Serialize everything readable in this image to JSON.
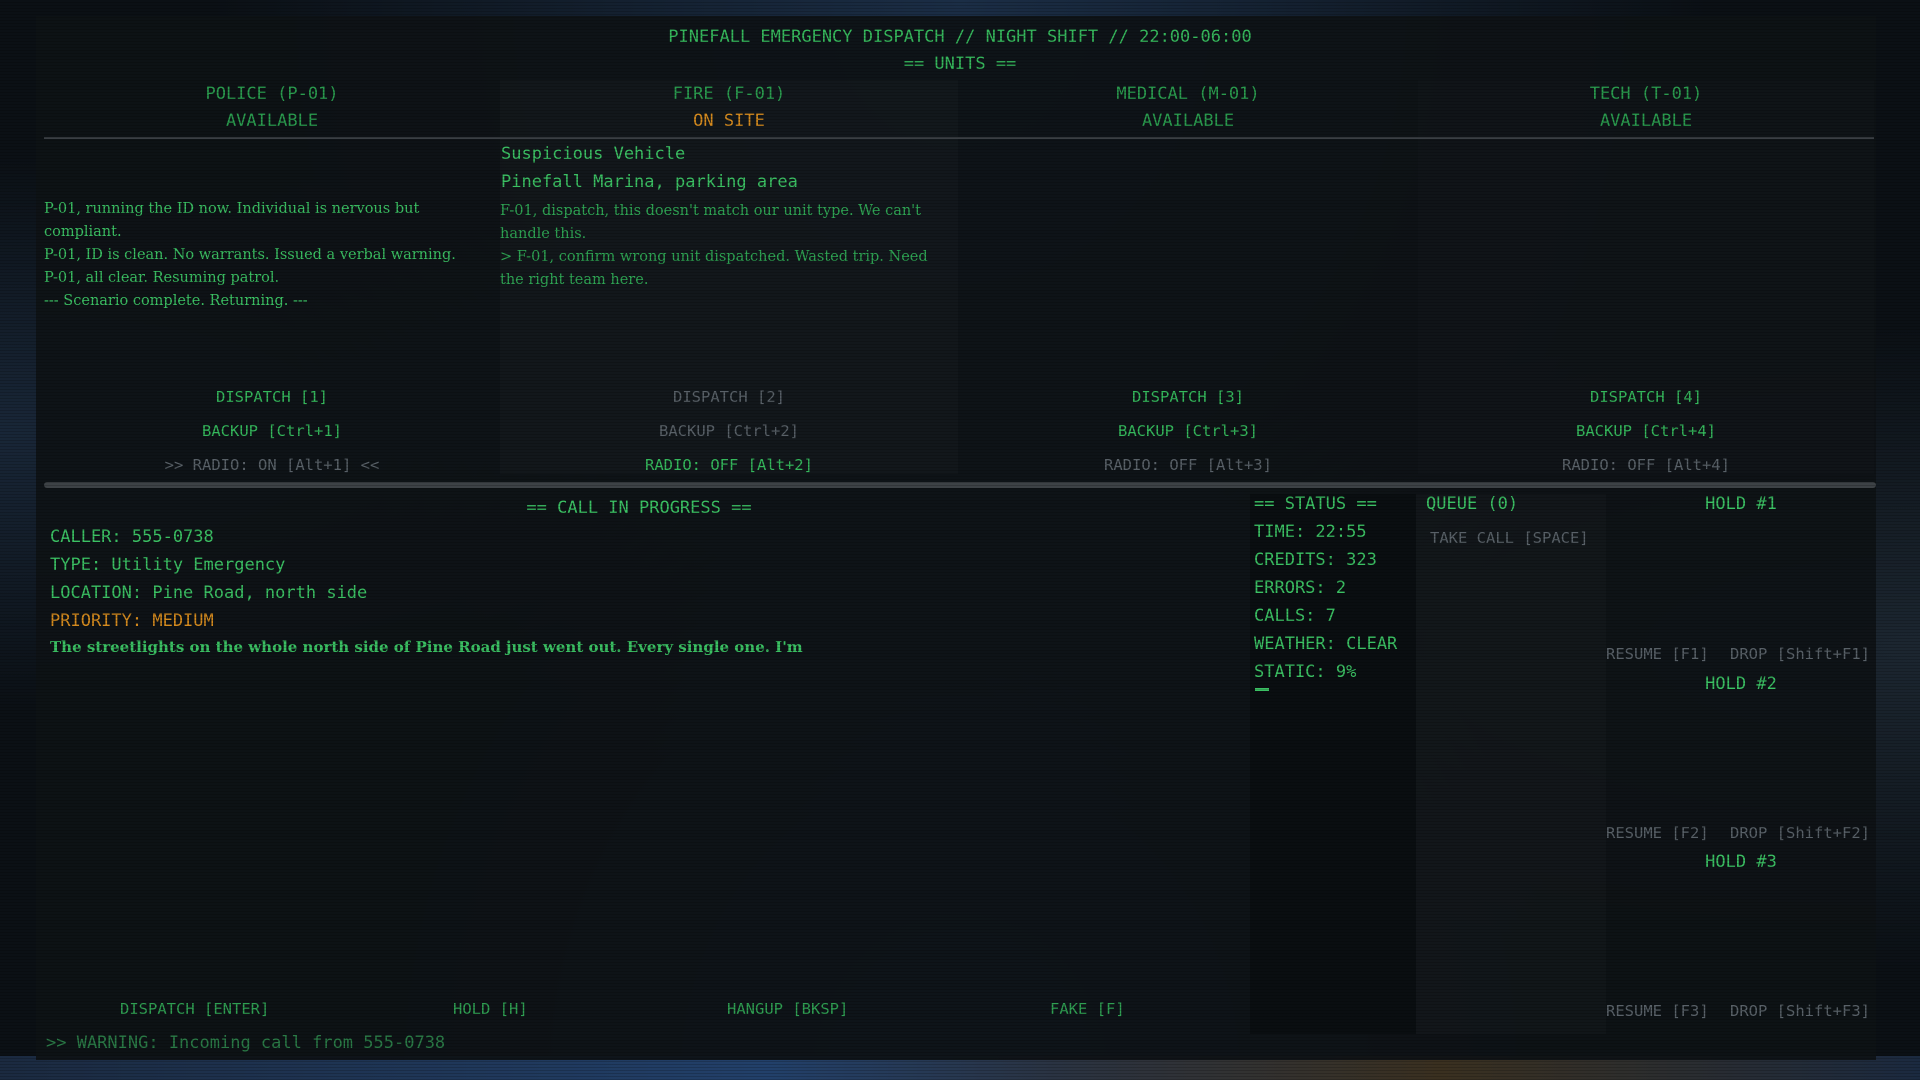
{
  "header": {
    "title": "PINEFALL EMERGENCY DISPATCH // NIGHT SHIFT // 22:00-06:00",
    "units_heading": "== UNITS =="
  },
  "units": [
    {
      "name": "POLICE (P-01)",
      "status": "AVAILABLE",
      "log": [
        "  P-01, running the ID now. Individual is nervous but compliant.",
        "  P-01, ID is clean. No warrants. Issued a verbal warning.",
        "  P-01, all clear. Resuming patrol.",
        "  --- Scenario complete. Returning. ---"
      ],
      "dispatch": "DISPATCH [1]",
      "backup": "BACKUP [Ctrl+1]",
      "radio": ">> RADIO: ON [Alt+1] <<"
    },
    {
      "name": "FIRE (F-01)",
      "status": "ON SITE",
      "incident_title": "Suspicious Vehicle",
      "incident_location": "Pinefall Marina, parking area",
      "log": [
        "  F-01, dispatch, this doesn't match our unit type. We can't handle this.",
        "> F-01, confirm wrong unit dispatched. Wasted trip. Need the right team here."
      ],
      "dispatch": "DISPATCH [2]",
      "backup": "BACKUP [Ctrl+2]",
      "radio": "RADIO: OFF [Alt+2]"
    },
    {
      "name": "MEDICAL (M-01)",
      "status": "AVAILABLE",
      "dispatch": "DISPATCH [3]",
      "backup": "BACKUP [Ctrl+3]",
      "radio": "RADIO: OFF [Alt+3]"
    },
    {
      "name": "TECH (T-01)",
      "status": "AVAILABLE",
      "dispatch": "DISPATCH [4]",
      "backup": "BACKUP [Ctrl+4]",
      "radio": "RADIO: OFF [Alt+4]"
    }
  ],
  "call": {
    "heading": "== CALL IN PROGRESS ==",
    "caller": "CALLER: 555-0738",
    "type": "TYPE: Utility Emergency",
    "location": "LOCATION: Pine Road, north side",
    "priority": "PRIORITY: MEDIUM",
    "transcript": "The streetlights on the whole north side of Pine Road just went out. Every single one. I'm",
    "actions": {
      "dispatch": "DISPATCH [ENTER]",
      "hold": "HOLD [H]",
      "hangup": "HANGUP [BKSP]",
      "fake": "FAKE [F]"
    }
  },
  "status": {
    "heading": "== STATUS ==",
    "time": "TIME: 22:55",
    "credits": "CREDITS: 323",
    "errors": "ERRORS: 2",
    "calls": "CALLS: 7",
    "weather": "WEATHER: CLEAR",
    "static": "STATIC: 9%",
    "static_level": 0.09
  },
  "queue": {
    "heading": "QUEUE (0)",
    "take_call": "TAKE CALL [SPACE]"
  },
  "holds": [
    {
      "title": "HOLD #1",
      "resume": "RESUME [F1]",
      "drop": "DROP [Shift+F1]"
    },
    {
      "title": "HOLD #2",
      "resume": "RESUME [F2]",
      "drop": "DROP [Shift+F2]"
    },
    {
      "title": "HOLD #3",
      "resume": "RESUME [F3]",
      "drop": "DROP [Shift+F3]"
    }
  ],
  "warning": ">> WARNING: Incoming call from 555-0738",
  "colors": {
    "green": "#3bc063",
    "amber": "#d48a1e",
    "dim": "#596168"
  }
}
